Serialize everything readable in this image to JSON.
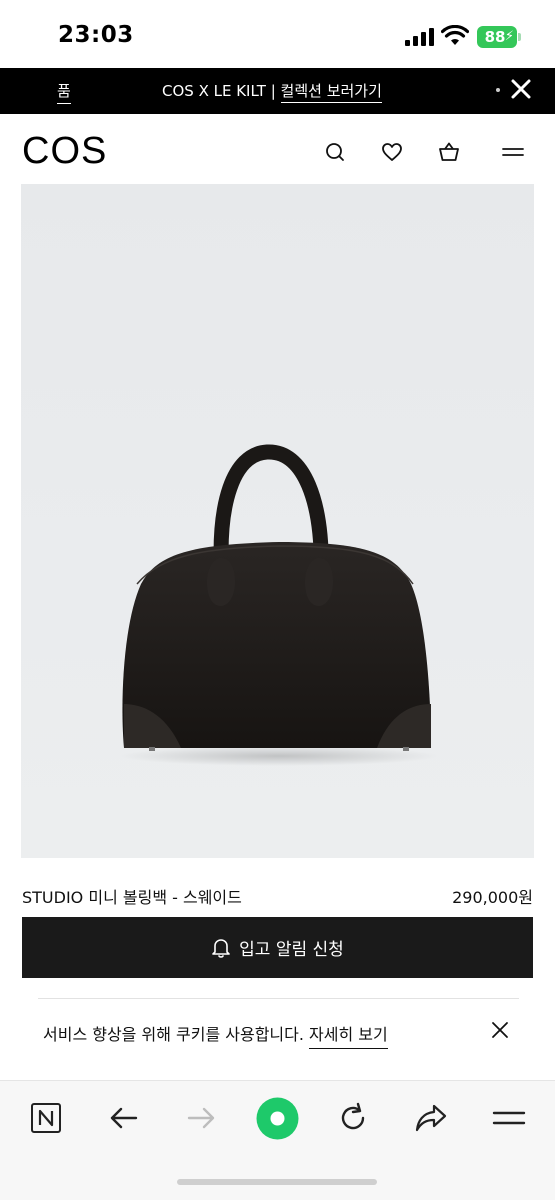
{
  "status_bar": {
    "time": "23:03",
    "battery": "88",
    "colors": {
      "battery": "#34c759"
    }
  },
  "promo_banner": {
    "left_text": "품",
    "text_prefix": "COS X LE KILT | ",
    "link_text": "컬렉션 보러가기",
    "background": "#000000"
  },
  "header": {
    "logo": "COS",
    "icons": [
      "search-icon",
      "heart-icon",
      "shopping-bag-icon",
      "menu-icon"
    ]
  },
  "product": {
    "image_subject": "black suede mini bowling bag",
    "name": "STUDIO 미니 볼링백 - 스웨이드",
    "price": "290,000원",
    "notify_label": "입고 알림 신청"
  },
  "cookie_notice": {
    "text": "서비스 향상을 위해 쿠키를 사용합니다. ",
    "link": "자세히 보기"
  },
  "browser_bar": {
    "icons": [
      "naver-n-icon",
      "back-arrow-icon",
      "forward-arrow-icon",
      "green-dot-icon",
      "reload-icon",
      "share-icon",
      "menu-icon"
    ],
    "colors": {
      "green_button": "#1ec96a"
    }
  }
}
